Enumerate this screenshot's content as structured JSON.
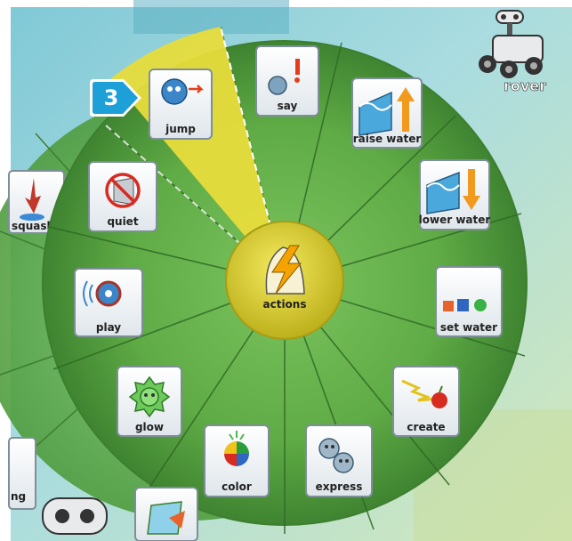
{
  "menu": {
    "center": {
      "label": "actions"
    },
    "items": [
      {
        "key": "jump",
        "label": "jump",
        "selected": true
      },
      {
        "key": "say",
        "label": "say"
      },
      {
        "key": "raise_water",
        "label": "raise water"
      },
      {
        "key": "lower_water",
        "label": "lower water"
      },
      {
        "key": "set_water",
        "label": "set water"
      },
      {
        "key": "create",
        "label": "create"
      },
      {
        "key": "express",
        "label": "express"
      },
      {
        "key": "color",
        "label": "color"
      },
      {
        "key": "glow",
        "label": "glow"
      },
      {
        "key": "play",
        "label": "play"
      },
      {
        "key": "quiet",
        "label": "quiet"
      }
    ]
  },
  "outer_menu": {
    "items": [
      {
        "label": "squasl"
      },
      {
        "label": "ng"
      }
    ]
  },
  "character": {
    "label": "rover"
  },
  "callout": {
    "number": "3"
  },
  "colors": {
    "wheel_green": "#4f9f3e",
    "wheel_green_dark": "#3c7f2f",
    "highlight_yellow": "#e7dc3c",
    "center_yellow": "#e2d630",
    "badge_blue": "#1d9fd8",
    "tile_border": "#7f8f99"
  }
}
